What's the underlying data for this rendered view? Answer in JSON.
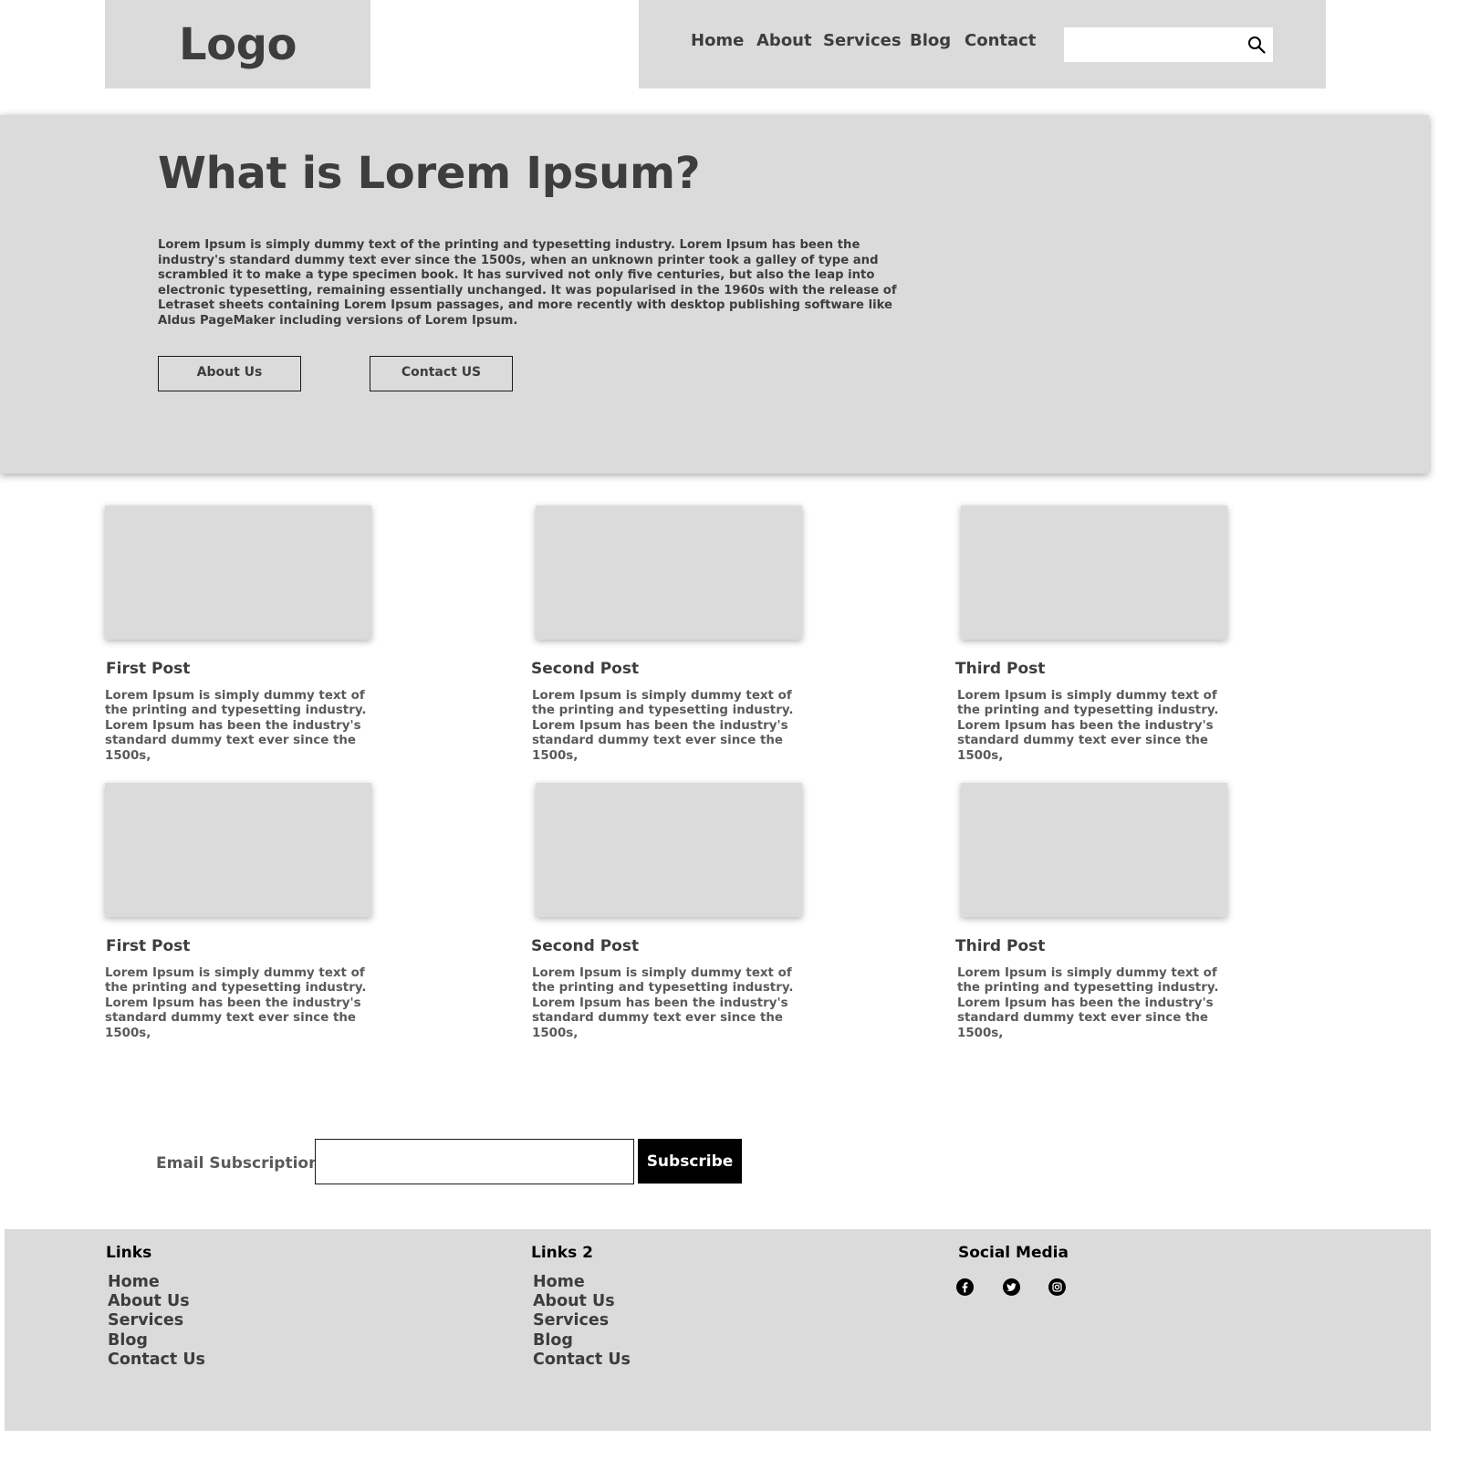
{
  "header": {
    "logo": "Logo",
    "nav": [
      "Home",
      "About",
      "Services",
      "Blog",
      "Contact"
    ],
    "search": {
      "value": "",
      "placeholder": ""
    }
  },
  "hero": {
    "title": "What is Lorem Ipsum?",
    "text": "Lorem Ipsum is simply dummy text of the printing and typesetting industry. Lorem Ipsum has been the industry's standard dummy text ever since the 1500s, when an unknown printer took a galley of type and scrambled it to make a type specimen book. It has survived not only five centuries, but also the leap into electronic typesetting, remaining essentially unchanged. It was popularised in the 1960s with the release of Letraset sheets containing Lorem Ipsum passages, and more recently with desktop publishing software like Aldus PageMaker including versions of Lorem Ipsum.",
    "buttons": [
      "About Us",
      "Contact US"
    ]
  },
  "posts": [
    {
      "title": "First Post",
      "text": "Lorem Ipsum is simply dummy text of the printing and typesetting industry. Lorem Ipsum has been the industry's standard dummy text ever since the 1500s,"
    },
    {
      "title": "Second Post",
      "text": "Lorem Ipsum is simply dummy text of the printing and typesetting industry. Lorem Ipsum has been the industry's standard dummy text ever since the 1500s,"
    },
    {
      "title": "Third Post",
      "text": "Lorem Ipsum is simply dummy text of the printing and typesetting industry. Lorem Ipsum has been the industry's standard dummy text ever since the 1500s,"
    },
    {
      "title": "First Post",
      "text": "Lorem Ipsum is simply dummy text of the printing and typesetting industry. Lorem Ipsum has been the industry's standard dummy text ever since the 1500s,"
    },
    {
      "title": "Second Post",
      "text": "Lorem Ipsum is simply dummy text of the printing and typesetting industry. Lorem Ipsum has been the industry's standard dummy text ever since the 1500s,"
    },
    {
      "title": "Third Post",
      "text": "Lorem Ipsum is simply dummy text of the printing and typesetting industry. Lorem Ipsum has been the industry's standard dummy text ever since the 1500s,"
    }
  ],
  "subscription": {
    "label": "Email Subscription",
    "input_value": "",
    "button": "Subscribe"
  },
  "footer": {
    "links": {
      "heading": "Links",
      "items": [
        "Home",
        "About Us",
        "Services",
        "Blog",
        "Contact Us"
      ]
    },
    "links2": {
      "heading": "Links 2",
      "items": [
        "Home",
        "About Us",
        "Services",
        "Blog",
        "Contact Us"
      ]
    },
    "social": {
      "heading": "Social Media",
      "icons": [
        "facebook-icon",
        "twitter-icon",
        "instagram-icon"
      ]
    }
  },
  "colors": {
    "placeholder_gray": "#dbdbdb",
    "text_dark": "#3d3d3d",
    "button_black": "#000000"
  }
}
